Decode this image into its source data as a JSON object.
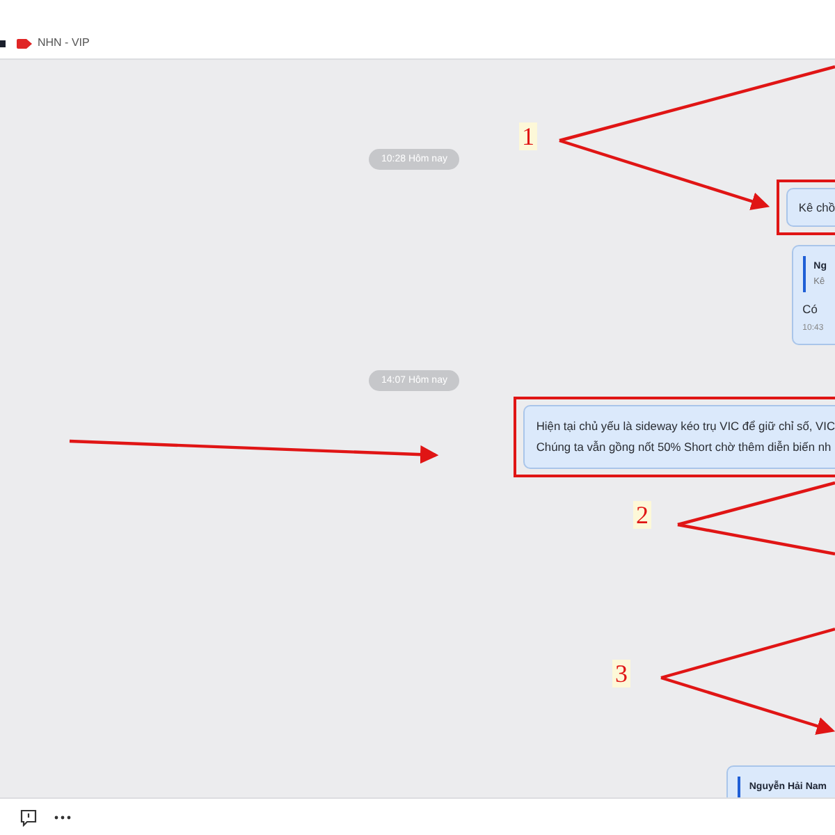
{
  "header": {
    "tag": "NHN - VIP"
  },
  "messages": [
    {
      "kind": "time",
      "text": "10:28 Hôm nay"
    },
    {
      "kind": "bubble",
      "lines": [
        "Kê chồ"
      ],
      "highlighted": true
    },
    {
      "kind": "reply",
      "quote_author": "Ng",
      "quote_text": "Kê",
      "text": "Có",
      "time": "10:43"
    },
    {
      "kind": "time",
      "text": "14:07 Hôm nay"
    },
    {
      "kind": "bubble",
      "lines": [
        "Hiện tại chủ yếu là sideway kéo trụ VIC để giữ chỉ số, VIC",
        "Chúng ta vẫn gồng nốt 50% Short chờ thêm diễn biến nh"
      ],
      "highlighted": true
    },
    {
      "kind": "reply",
      "quote_author": "Nguyễn Hải Nam"
    }
  ],
  "annotations": [
    {
      "label": "1"
    },
    {
      "label": "2"
    },
    {
      "label": "3"
    }
  ]
}
